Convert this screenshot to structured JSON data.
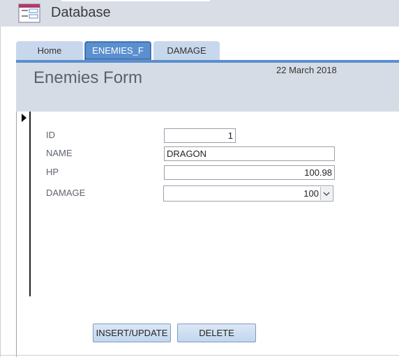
{
  "app": {
    "title": "Database"
  },
  "tabs": [
    {
      "label": "Home",
      "active": false
    },
    {
      "label": "ENEMIES_F",
      "active": true
    },
    {
      "label": "DAMAGE",
      "active": false
    }
  ],
  "form": {
    "title": "Enemies Form",
    "date": "22 March 2018",
    "fields": {
      "id": {
        "label": "ID",
        "value": "1"
      },
      "name": {
        "label": "NAME",
        "value": "DRAGON"
      },
      "hp": {
        "label": "HP",
        "value": "100.98"
      },
      "damage": {
        "label": "DAMAGE",
        "value": "100"
      }
    },
    "buttons": {
      "insert_update": "INSERT/UPDATE",
      "delete": "DELETE"
    }
  },
  "colors": {
    "accent": "#5b8fcf",
    "header_bg": "#d6dce5",
    "tab_inactive": "#c8d8ec"
  },
  "icons": {
    "app": "form-table-icon",
    "record_selector": "current-record-arrow-icon",
    "dropdown": "chevron-down-icon"
  }
}
